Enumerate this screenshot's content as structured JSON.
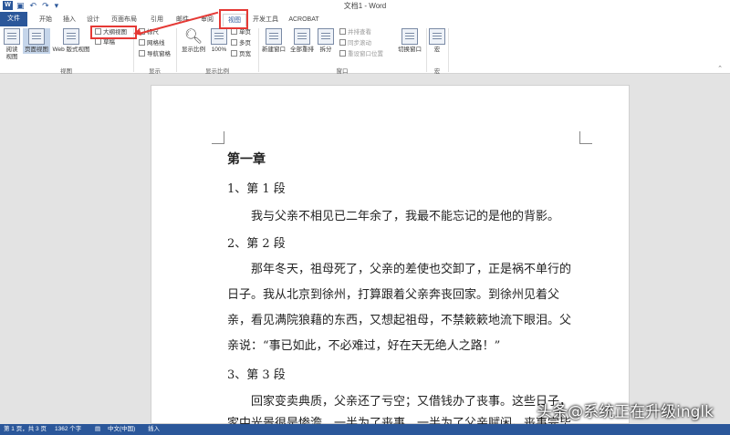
{
  "title_bar": {
    "app_logo": "W",
    "title": "文档1 - Word",
    "qat_icons": [
      "save-icon",
      "undo-icon",
      "redo-icon"
    ]
  },
  "tabs": [
    {
      "label": "文件"
    },
    {
      "label": "开始"
    },
    {
      "label": "插入"
    },
    {
      "label": "设计"
    },
    {
      "label": "页面布局"
    },
    {
      "label": "引用"
    },
    {
      "label": "邮件"
    },
    {
      "label": "审阅"
    },
    {
      "label": "视图"
    },
    {
      "label": "开发工具"
    },
    {
      "label": "ACROBAT"
    }
  ],
  "ribbon": {
    "views": {
      "read": "阅读\n视图",
      "print": "页面视图",
      "web": "Web 版式视图",
      "outline": "大纲视图",
      "draft": "草稿",
      "group_label": "视图"
    },
    "show": {
      "ruler": "标尺",
      "gridlines": "网格线",
      "nav": "导航窗格",
      "group_label": "显示"
    },
    "zoom": {
      "zoom": "显示比例",
      "pct": "100%",
      "one_page": "单页",
      "multi_page": "多页",
      "page_width": "页宽",
      "group_label": "显示比例"
    },
    "window": {
      "new_window": "新建窗口",
      "arrange_all": "全部重排",
      "split": "拆分",
      "side_by_side": "并排查看",
      "sync_scroll": "同步滚动",
      "reset_pos": "重设窗口位置",
      "switch": "切换窗口",
      "group_label": "窗口"
    },
    "macros": {
      "macros": "宏",
      "group_label": "宏"
    }
  },
  "document": {
    "lines": [
      "第一章",
      "1、第 1 段",
      "我与父亲不相见已二年余了，我最不能忘记的是他的背影。",
      "2、第 2 段",
      "那年冬天，祖母死了，父亲的差使也交卸了，正是祸不单行的",
      "日子。我从北京到徐州，打算跟着父亲奔丧回家。到徐州见着父",
      "亲，看见满院狼藉的东西，又想起祖母，不禁簌簌地流下眼泪。父",
      "亲说：“事已如此，不必难过，好在天无绝人之路！”",
      "3、第 3 段",
      "回家变卖典质，父亲还了亏空；又借钱办了丧事。这些日子，",
      "家中光景很是惨澹，一半为了丧事，一半为了父亲赋闲。丧事完毕"
    ]
  },
  "status_bar": {
    "page": "第 1 页，共 3 页",
    "words": "1362 个字",
    "proofing_icon": "proofing-icon",
    "lang": "中文(中国)",
    "mode": "插入"
  },
  "watermark": "头条@系统正在升级inglk",
  "colors": {
    "brand": "#2b579a",
    "highlight": "#e53935"
  }
}
